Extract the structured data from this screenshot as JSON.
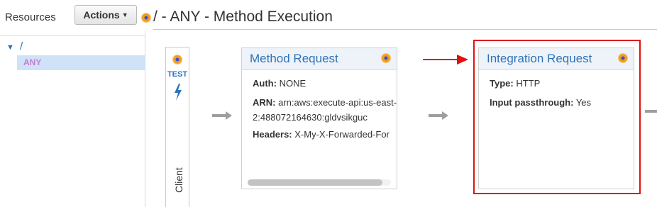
{
  "sidebar": {
    "resources_label": "Resources",
    "actions_label": "Actions",
    "tree": {
      "root": "/",
      "selected_method": "ANY"
    }
  },
  "header": {
    "title": "/ - ANY - Method Execution"
  },
  "test_panel": {
    "label": "TEST",
    "client_label": "Client"
  },
  "method_request": {
    "title": "Method Request",
    "fields": [
      {
        "key": "Auth:",
        "value": "NONE"
      },
      {
        "key": "ARN:",
        "value": "arn:aws:execute-api:us-east-2:488072164630:gldvsikguc"
      },
      {
        "key": "Headers:",
        "value": "X-My-X-Forwarded-For"
      }
    ]
  },
  "integration_request": {
    "title": "Integration Request",
    "fields": [
      {
        "key": "Type:",
        "value": "HTTP"
      },
      {
        "key": "Input passthrough:",
        "value": "Yes"
      }
    ]
  },
  "colors": {
    "link": "#2e73b8",
    "highlight": "#e01010",
    "selected_row": "#cfe2f7",
    "method_text": "#c47fd2"
  },
  "icons": [
    "status-orb-icon",
    "lightning-bolt-icon",
    "caret-down-icon",
    "arrow-right-icon"
  ]
}
